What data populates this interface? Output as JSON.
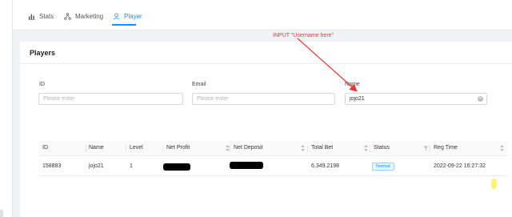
{
  "tabs": [
    {
      "label": "Stats",
      "icon": "bar-chart-icon"
    },
    {
      "label": "Marketing",
      "icon": "network-icon"
    },
    {
      "label": "Player",
      "icon": "user-icon",
      "active": true
    }
  ],
  "annotation": {
    "text": "INPUT \"Username here\"",
    "color": "#e53935"
  },
  "card": {
    "title": "Players"
  },
  "filters": {
    "id": {
      "label": "ID",
      "placeholder": "Please enter",
      "value": ""
    },
    "email": {
      "label": "Email",
      "placeholder": "Please enter",
      "value": ""
    },
    "name": {
      "label": "Name",
      "placeholder": "Please enter",
      "value": "jojo21"
    }
  },
  "table": {
    "columns": [
      "ID",
      "Name",
      "Level",
      "Net Profit",
      "Net Deposit",
      "Total Bet",
      "Status",
      "Reg Time"
    ],
    "rows": [
      {
        "id": "158883",
        "name": "jojo21",
        "level": "1",
        "total_bet": "6,349.2198",
        "status": "Normal",
        "reg_time": "2022-09-22 16:27:32"
      }
    ]
  },
  "colors": {
    "accent": "#1890ff",
    "annotation": "#e53935",
    "status_bg": "#e6f7ff"
  }
}
